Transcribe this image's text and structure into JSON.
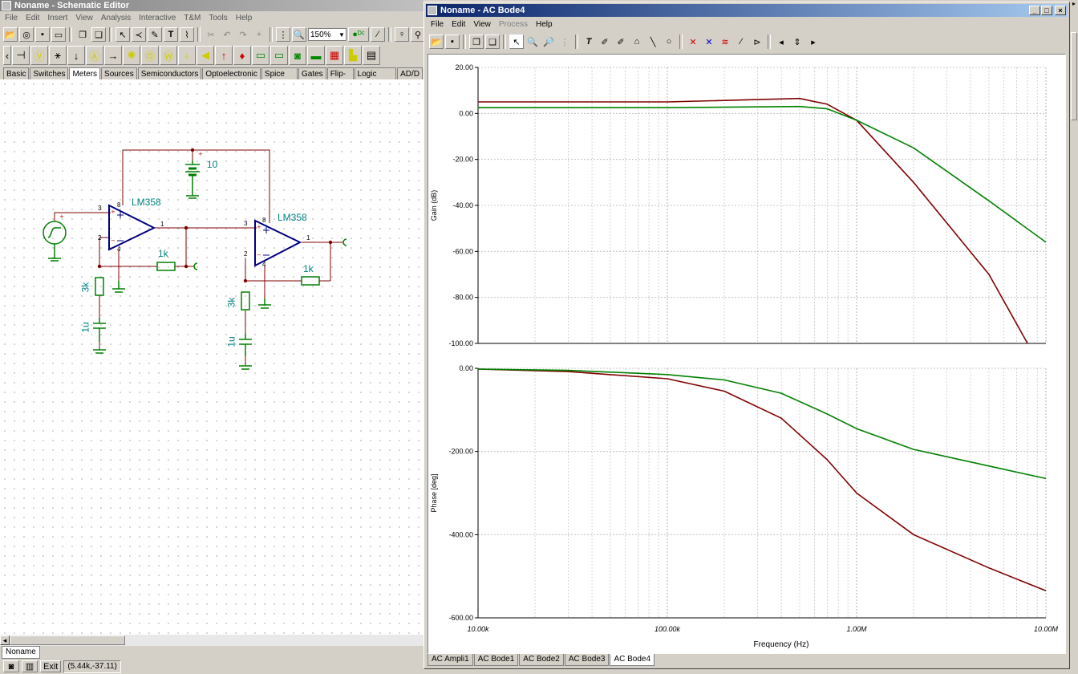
{
  "schematic": {
    "title": "Noname - Schematic Editor",
    "menu": [
      "File",
      "Edit",
      "Insert",
      "View",
      "Analysis",
      "Interactive",
      "T&M",
      "Tools",
      "Help"
    ],
    "zoom": "150%",
    "categories": [
      "Basic",
      "Switches",
      "Meters",
      "Sources",
      "Semiconductors",
      "Optoelectronic",
      "Spice Macros",
      "Gates",
      "Flip-flops",
      "Logic ICs-MCUs",
      "AD/D"
    ],
    "selected_category": "Meters",
    "labels": {
      "battery": "10",
      "opamp1": "LM358",
      "opamp2": "LM358",
      "r1": "1k",
      "r2": "3k",
      "c1": "1u",
      "r3": "1k",
      "r4": "3k",
      "c2": "1u"
    },
    "pins": {
      "p3a": "3",
      "p2a": "2",
      "p1a": "1",
      "p8a": "8",
      "p4a": "4",
      "p3b": "3",
      "p2b": "2",
      "p1b": "1",
      "p8b": "8",
      "p4b": "4"
    },
    "sheet_tab": "Noname",
    "exit_label": "Exit",
    "coords": "(5.44k,-37.11)"
  },
  "bode": {
    "title": "Noname - AC Bode4",
    "menu": [
      "File",
      "Edit",
      "View",
      "Process",
      "Help"
    ],
    "disabled_menu": "Process",
    "tabs": [
      "AC Ampli1",
      "AC Bode1",
      "AC Bode2",
      "AC Bode3",
      "AC Bode4"
    ],
    "selected_tab": "AC Bode4",
    "window_buttons": [
      "_",
      "□",
      "×"
    ]
  },
  "chart_data": [
    {
      "type": "line",
      "xlabel": "",
      "ylabel": "Gain (dB)",
      "xscale": "log",
      "xlim": [
        10000,
        10000000
      ],
      "ylim": [
        -100,
        20
      ],
      "yticks": [
        "20.00",
        "0.00",
        "-20.00",
        "-40.00",
        "-60.00",
        "-80.00",
        "-100.00"
      ],
      "grid": true,
      "series": [
        {
          "color": "#800000",
          "points": [
            [
              10000,
              5
            ],
            [
              100000,
              5
            ],
            [
              300000,
              6
            ],
            [
              500000,
              6.5
            ],
            [
              700000,
              4
            ],
            [
              1000000,
              -3
            ],
            [
              2000000,
              -30
            ],
            [
              5000000,
              -70
            ],
            [
              8000000,
              -100
            ]
          ]
        },
        {
          "color": "#008000",
          "points": [
            [
              10000,
              2.5
            ],
            [
              100000,
              2.5
            ],
            [
              500000,
              3
            ],
            [
              700000,
              2
            ],
            [
              1000000,
              -3
            ],
            [
              2000000,
              -15
            ],
            [
              5000000,
              -38
            ],
            [
              10000000,
              -56
            ]
          ]
        }
      ]
    },
    {
      "type": "line",
      "xlabel": "Frequency (Hz)",
      "ylabel": "Phase [deg]",
      "xscale": "log",
      "xlim": [
        10000,
        10000000
      ],
      "ylim": [
        -600,
        0
      ],
      "yticks": [
        "0.00",
        "-200.00",
        "-400.00",
        "-600.00"
      ],
      "xticks": [
        "10.00k",
        "100.00k",
        "1.00M",
        "10.00M"
      ],
      "grid": true,
      "series": [
        {
          "color": "#800000",
          "points": [
            [
              10000,
              -2
            ],
            [
              30000,
              -8
            ],
            [
              100000,
              -25
            ],
            [
              200000,
              -55
            ],
            [
              400000,
              -120
            ],
            [
              700000,
              -220
            ],
            [
              1000000,
              -300
            ],
            [
              2000000,
              -400
            ],
            [
              5000000,
              -480
            ],
            [
              10000000,
              -535
            ]
          ]
        },
        {
          "color": "#008000",
          "points": [
            [
              10000,
              -2
            ],
            [
              30000,
              -5
            ],
            [
              100000,
              -15
            ],
            [
              200000,
              -28
            ],
            [
              400000,
              -60
            ],
            [
              700000,
              -110
            ],
            [
              1000000,
              -145
            ],
            [
              2000000,
              -195
            ],
            [
              5000000,
              -235
            ],
            [
              10000000,
              -265
            ]
          ]
        }
      ]
    }
  ]
}
